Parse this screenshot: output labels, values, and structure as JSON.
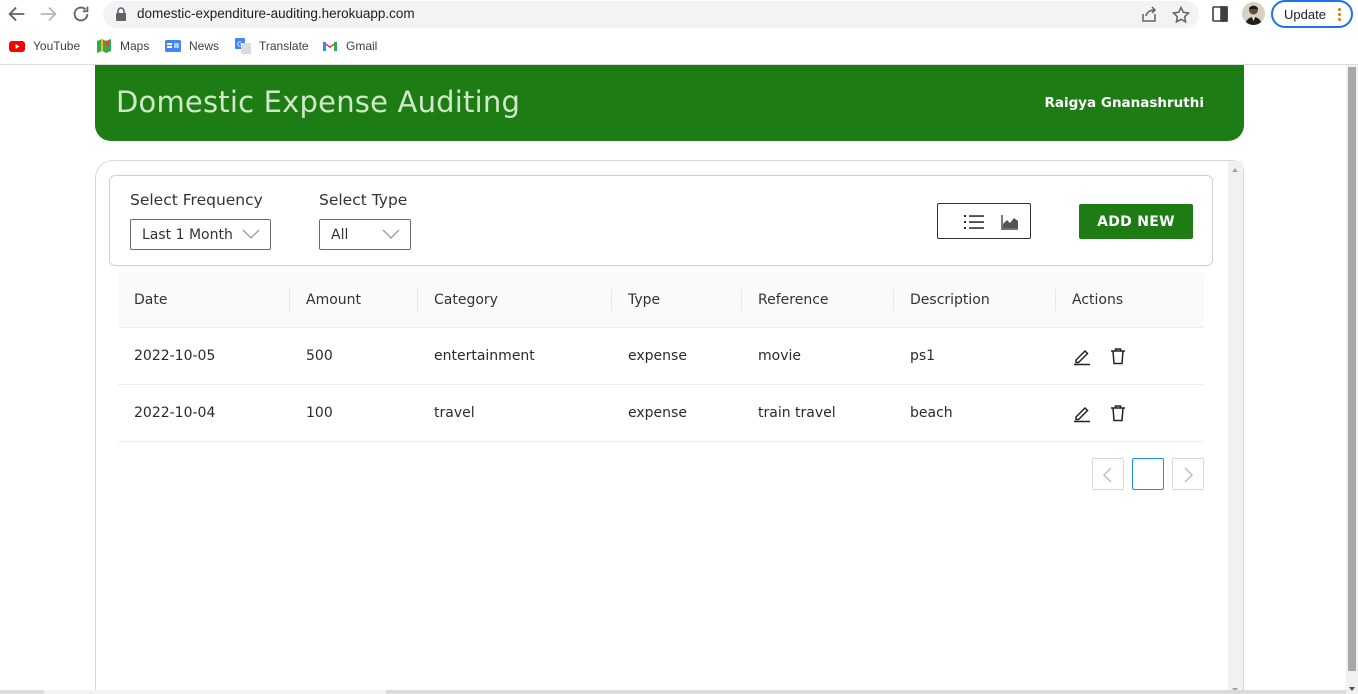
{
  "browser": {
    "url": "domestic-expenditure-auditing.herokuapp.com",
    "update_label": "Update",
    "bookmarks": [
      {
        "label": "YouTube",
        "icon": "youtube-icon"
      },
      {
        "label": "Maps",
        "icon": "maps-icon"
      },
      {
        "label": "News",
        "icon": "news-icon"
      },
      {
        "label": "Translate",
        "icon": "translate-icon"
      },
      {
        "label": "Gmail",
        "icon": "gmail-icon"
      }
    ]
  },
  "header": {
    "title": "Domestic Expense Auditing",
    "user_name": "Raigya Gnanashruthi"
  },
  "filters": {
    "frequency_label": "Select Frequency",
    "frequency_value": "Last 1 Month",
    "type_label": "Select Type",
    "type_value": "All",
    "add_button_label": "ADD NEW"
  },
  "table": {
    "columns": [
      "Date",
      "Amount",
      "Category",
      "Type",
      "Reference",
      "Description",
      "Actions"
    ],
    "rows": [
      {
        "date": "2022-10-05",
        "amount": "500",
        "category": "entertainment",
        "type": "expense",
        "reference": "movie",
        "description": "ps1"
      },
      {
        "date": "2022-10-04",
        "amount": "100",
        "category": "travel",
        "type": "expense",
        "reference": "train travel",
        "description": "beach"
      }
    ]
  },
  "pagination": {
    "current_page": ""
  },
  "colors": {
    "brand_green": "#1d7d14",
    "title_text": "#cfe8c8",
    "active_page_border": "#1890ff"
  }
}
